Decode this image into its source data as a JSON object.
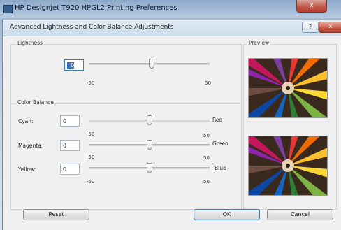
{
  "outer_window": {
    "title": "HP Designjet T920 HPGL2 Printing Preferences",
    "close_glyph": "x"
  },
  "dialog": {
    "title": "Advanced Lightness and Color Balance Adjustments",
    "help_glyph": "?",
    "close_glyph": "x"
  },
  "lightness": {
    "group_label": "Lightness",
    "value": "0",
    "slider_value": 0,
    "min_label": "-50",
    "max_label": "50"
  },
  "color_balance": {
    "group_label": "Color Balance",
    "rows": [
      {
        "label": "Cyan:",
        "value": "0",
        "slider_value": 0,
        "color": "Red",
        "min_label": "-50",
        "max_label": "50"
      },
      {
        "label": "Magenta:",
        "value": "0",
        "slider_value": 0,
        "color": "Green",
        "min_label": "-50",
        "max_label": "50"
      },
      {
        "label": "Yellow:",
        "value": "0",
        "slider_value": 0,
        "color": "Blue",
        "min_label": "-50",
        "max_label": "50"
      }
    ]
  },
  "preview": {
    "label": "Preview",
    "image_subject": "colored-pencils"
  },
  "buttons": {
    "reset": "Reset",
    "ok": "OK",
    "cancel": "Cancel"
  },
  "colors": {
    "focus_border": "#3c7fb1",
    "close_red": "#c75a49"
  }
}
